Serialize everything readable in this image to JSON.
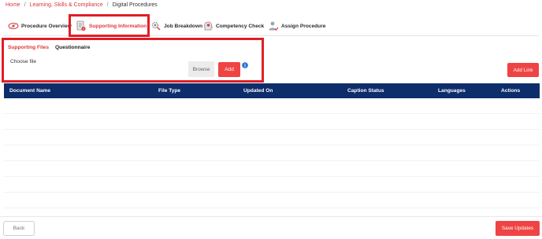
{
  "breadcrumb": {
    "items": [
      "Home",
      "Learning, Skills & Compliance",
      "Digital Procedures"
    ],
    "separator": "/"
  },
  "tabs": [
    {
      "label": "Procedure Overview",
      "icon": "eye-icon",
      "active": false
    },
    {
      "label": "Supporting Information",
      "icon": "document-icon",
      "active": true
    },
    {
      "label": "Job Breakdown",
      "icon": "gear-search-icon",
      "active": false
    },
    {
      "label": "Competency Check",
      "icon": "head-gear-icon",
      "active": false
    },
    {
      "label": "Assign Procedure",
      "icon": "user-check-icon",
      "active": false
    }
  ],
  "subtabs": [
    {
      "label": "Supporting Files",
      "active": true
    },
    {
      "label": "Questionnaire",
      "active": false
    }
  ],
  "upload": {
    "placeholder": "Choose file",
    "browse_label": "Browse",
    "add_label": "Add",
    "info_icon": "info-icon"
  },
  "add_link_label": "Add Link",
  "table": {
    "columns": [
      "Document Name",
      "File Type",
      "Updated On",
      "Caption Status",
      "Languages",
      "Actions"
    ],
    "rows": []
  },
  "footer": {
    "back_label": "Back",
    "save_label": "Save Updates"
  },
  "colors": {
    "accent": "#ef4444",
    "link": "#d9363e",
    "table_header": "#0d2d6b",
    "highlight": "#e11d25"
  }
}
